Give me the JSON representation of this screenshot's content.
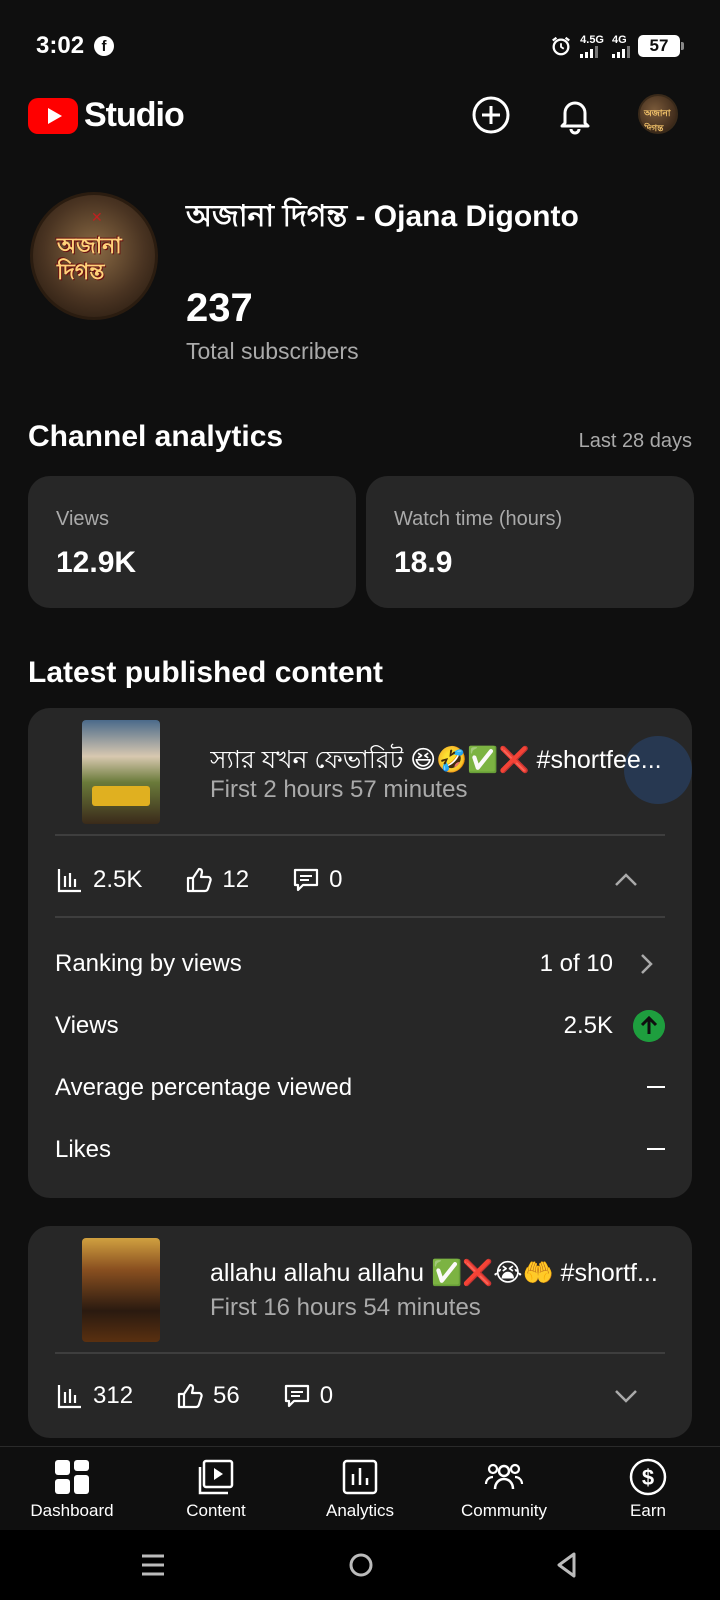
{
  "status_bar": {
    "time": "3:02",
    "network_1": "4.5G",
    "network_2": "4G",
    "battery": "57"
  },
  "app_bar": {
    "logo_text": "Studio",
    "avatar_text": "অজানা দিগন্ত"
  },
  "channel": {
    "name": "অজানা দিগন্ত - Ojana Digonto",
    "avatar_text": "অজানা দিগন্ত",
    "subscriber_count": "237",
    "subscriber_label": "Total subscribers"
  },
  "analytics": {
    "title": "Channel analytics",
    "range": "Last 28 days",
    "cards": [
      {
        "label": "Views",
        "value": "12.9K"
      },
      {
        "label": "Watch time (hours)",
        "value": "18.9"
      }
    ]
  },
  "latest": {
    "title": "Latest published content",
    "items": [
      {
        "title": "স্যার যখন ফেভারিট 😆🤣✅❌ #shortfee...",
        "subtitle": "First 2 hours 57 minutes",
        "views": "2.5K",
        "likes": "12",
        "comments": "0",
        "expanded": true,
        "details": [
          {
            "label": "Ranking by views",
            "value": "1 of 10"
          },
          {
            "label": "Views",
            "value": "2.5K"
          },
          {
            "label": "Average percentage viewed",
            "value": "—"
          },
          {
            "label": "Likes",
            "value": "—"
          }
        ]
      },
      {
        "title": "allahu allahu allahu  ✅❌😭🤲 #shortf...",
        "subtitle": "First 16 hours 54 minutes",
        "views": "312",
        "likes": "56",
        "comments": "0",
        "expanded": false
      }
    ]
  },
  "bottom_nav": [
    {
      "label": "Dashboard",
      "icon": "dashboard-icon"
    },
    {
      "label": "Content",
      "icon": "content-icon"
    },
    {
      "label": "Analytics",
      "icon": "analytics-icon"
    },
    {
      "label": "Community",
      "icon": "community-icon"
    },
    {
      "label": "Earn",
      "icon": "earn-icon"
    }
  ],
  "colors": {
    "background": "#0f0f0f",
    "card": "#272727",
    "brand_red": "#ff0000",
    "positive_green": "#1e9e3e",
    "secondary_text": "#aaaaaa"
  }
}
